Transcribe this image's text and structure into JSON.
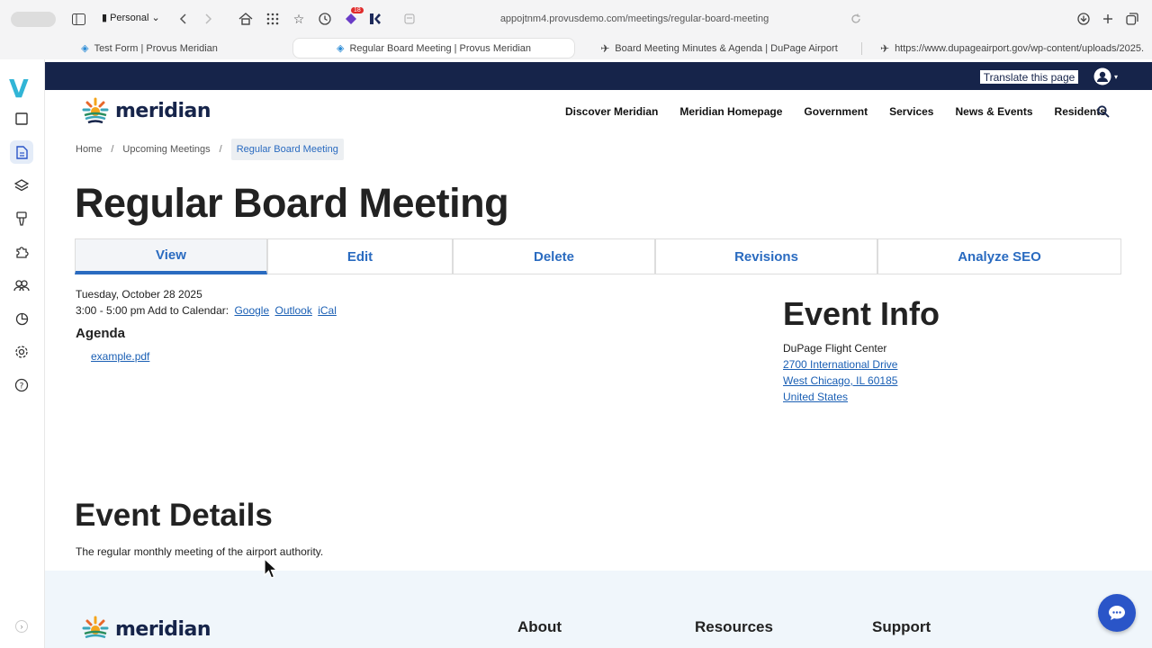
{
  "browser": {
    "profile": "Personal",
    "url": "appojtnm4.provusdemo.com/meetings/regular-board-meeting",
    "extension_badge": "18",
    "tabs": [
      {
        "title": "Test Form | Provus Meridian"
      },
      {
        "title": "Regular Board Meeting | Provus Meridian",
        "active": true
      },
      {
        "title": "Board Meeting Minutes & Agenda | DuPage Airport"
      },
      {
        "title": "https://www.dupageairport.gov/wp-content/uploads/2025..."
      }
    ]
  },
  "rail": {
    "logo": "V",
    "items": [
      "square-icon",
      "document-icon",
      "layers-icon",
      "brush-icon",
      "puzzle-icon",
      "users-icon",
      "pie-chart-icon",
      "gear-icon",
      "help-icon"
    ]
  },
  "site": {
    "translate_label": "Translate this page",
    "logo_text": "meridian",
    "nav": [
      "Discover Meridian",
      "Meridian Homepage",
      "Government",
      "Services",
      "News & Events",
      "Residents"
    ]
  },
  "breadcrumb": {
    "home": "Home",
    "parent": "Upcoming Meetings",
    "current": "Regular Board Meeting"
  },
  "page": {
    "title": "Regular Board Meeting",
    "tabs": [
      "View",
      "Edit",
      "Delete",
      "Revisions",
      "Analyze SEO"
    ],
    "date": "Tuesday, October 28 2025",
    "time": "3:00 - 5:00 pm Add to Calendar:",
    "calendar_links": [
      "Google",
      "Outlook",
      "iCal"
    ],
    "agenda_heading": "Agenda",
    "agenda_file": "example.pdf",
    "event_info_heading": "Event Info",
    "location_name": "DuPage Flight Center",
    "address_line1": "2700 International Drive",
    "address_line2": "West Chicago, IL 60185",
    "address_country": "United States",
    "event_details_heading": "Event Details",
    "event_details_text": "The regular monthly meeting of the airport authority."
  },
  "footer": {
    "logo_text": "meridian",
    "columns": [
      "About",
      "Resources",
      "Support"
    ]
  },
  "colors": {
    "brand_navy": "#16244a",
    "link_blue": "#1a5fb4",
    "accent_blue": "#2a6bc0",
    "footer_bg": "#f0f6fb"
  }
}
